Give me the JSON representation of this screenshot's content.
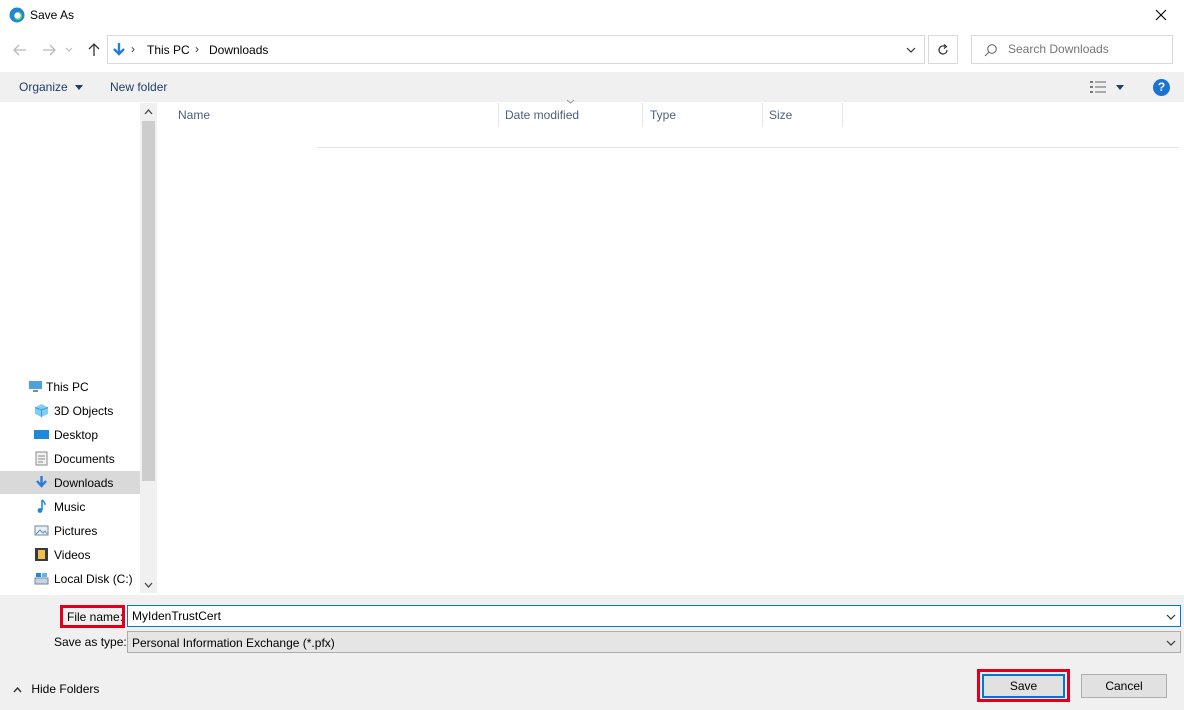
{
  "window": {
    "title": "Save As",
    "close_glyph": "✕"
  },
  "navigation": {
    "back_icon": "back-arrow-icon",
    "forward_icon": "forward-arrow-icon",
    "recent_icon": "chevron-down-icon",
    "up_icon": "up-arrow-icon"
  },
  "address": {
    "breadcrumbs": [
      "This PC",
      "Downloads"
    ],
    "separator": "›"
  },
  "search": {
    "placeholder": "Search Downloads"
  },
  "commandbar": {
    "organize_label": "Organize",
    "new_folder_label": "New folder",
    "help_label": "?"
  },
  "sidebar": {
    "root": "This PC",
    "items": [
      {
        "label": "3D Objects",
        "icon": "cube-icon"
      },
      {
        "label": "Desktop",
        "icon": "desktop-icon"
      },
      {
        "label": "Documents",
        "icon": "document-icon"
      },
      {
        "label": "Downloads",
        "icon": "download-icon",
        "selected": true
      },
      {
        "label": "Music",
        "icon": "music-note-icon"
      },
      {
        "label": "Pictures",
        "icon": "picture-icon"
      },
      {
        "label": "Videos",
        "icon": "film-icon"
      },
      {
        "label": "Local Disk (C:)",
        "icon": "disk-icon"
      }
    ]
  },
  "file_list": {
    "columns": [
      "Name",
      "Date modified",
      "Type",
      "Size"
    ],
    "rows": []
  },
  "form": {
    "file_name_label": "File name:",
    "file_name_value": "MyIdenTrustCert",
    "save_type_label": "Save as type:",
    "save_type_value": "Personal Information Exchange (*.pfx)"
  },
  "footer": {
    "hide_folders_label": "Hide Folders",
    "save_label": "Save",
    "cancel_label": "Cancel"
  },
  "colors": {
    "highlight": "#e0001b",
    "accent": "#0078d7",
    "panel_bg": "#f0f0f0"
  }
}
